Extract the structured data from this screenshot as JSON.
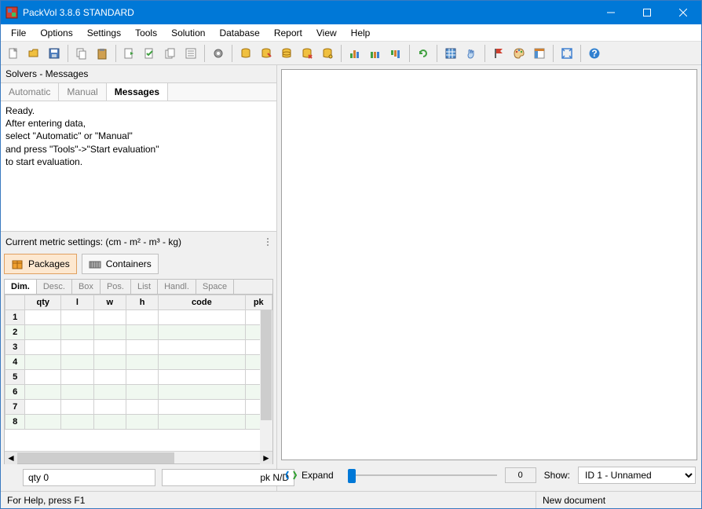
{
  "title": "PackVol 3.8.6 STANDARD",
  "menu": [
    "File",
    "Options",
    "Settings",
    "Tools",
    "Solution",
    "Database",
    "Report",
    "View",
    "Help"
  ],
  "toolbar_icons": [
    "new-file-icon",
    "open-folder-icon",
    "save-icon",
    "|",
    "copy-icon",
    "paste-icon",
    "|",
    "doc-right-icon",
    "doc-check-icon",
    "doc-stack-icon",
    "doc-list-icon",
    "|",
    "gear-icon",
    "|",
    "db-yellow-icon",
    "db-edit-icon",
    "db-stack-icon",
    "db-delete-icon",
    "db-key-icon",
    "|",
    "chart-bar-icon",
    "chart-group-icon",
    "chart-down-icon",
    "|",
    "refresh-icon",
    "|",
    "grid-icon",
    "hand-icon",
    "|",
    "flag-red-icon",
    "palette-icon",
    "layout-icon",
    "|",
    "fullscreen-icon",
    "|",
    "help-icon"
  ],
  "solvers": {
    "header": "Solvers - Messages",
    "tabs": [
      "Automatic",
      "Manual",
      "Messages"
    ],
    "active_tab": "Messages",
    "message_lines": [
      "Ready.",
      "After entering data,",
      "select \"Automatic\" or \"Manual\"",
      "and press \"Tools\"->\"Start evaluation\"",
      "to start evaluation."
    ]
  },
  "metric_line": "Current metric settings: (cm - m² - m³ - kg)",
  "pc_buttons": {
    "packages": "Packages",
    "containers": "Containers",
    "active": "packages"
  },
  "small_tabs": [
    "Dim.",
    "Desc.",
    "Box",
    "Pos.",
    "List",
    "Handl.",
    "Space"
  ],
  "small_tabs_active": "Dim.",
  "grid": {
    "headers": [
      "qty",
      "l",
      "w",
      "h",
      "code",
      "pk"
    ],
    "row_count": 8
  },
  "below_grid": {
    "qty": "qty 0",
    "pk": "pk N/D"
  },
  "right_controls": {
    "expand": "Expand",
    "slider_value": "0",
    "show_label": "Show:",
    "show_selected": "ID 1 - Unnamed"
  },
  "status": {
    "left": "For Help, press F1",
    "right": "New document"
  }
}
